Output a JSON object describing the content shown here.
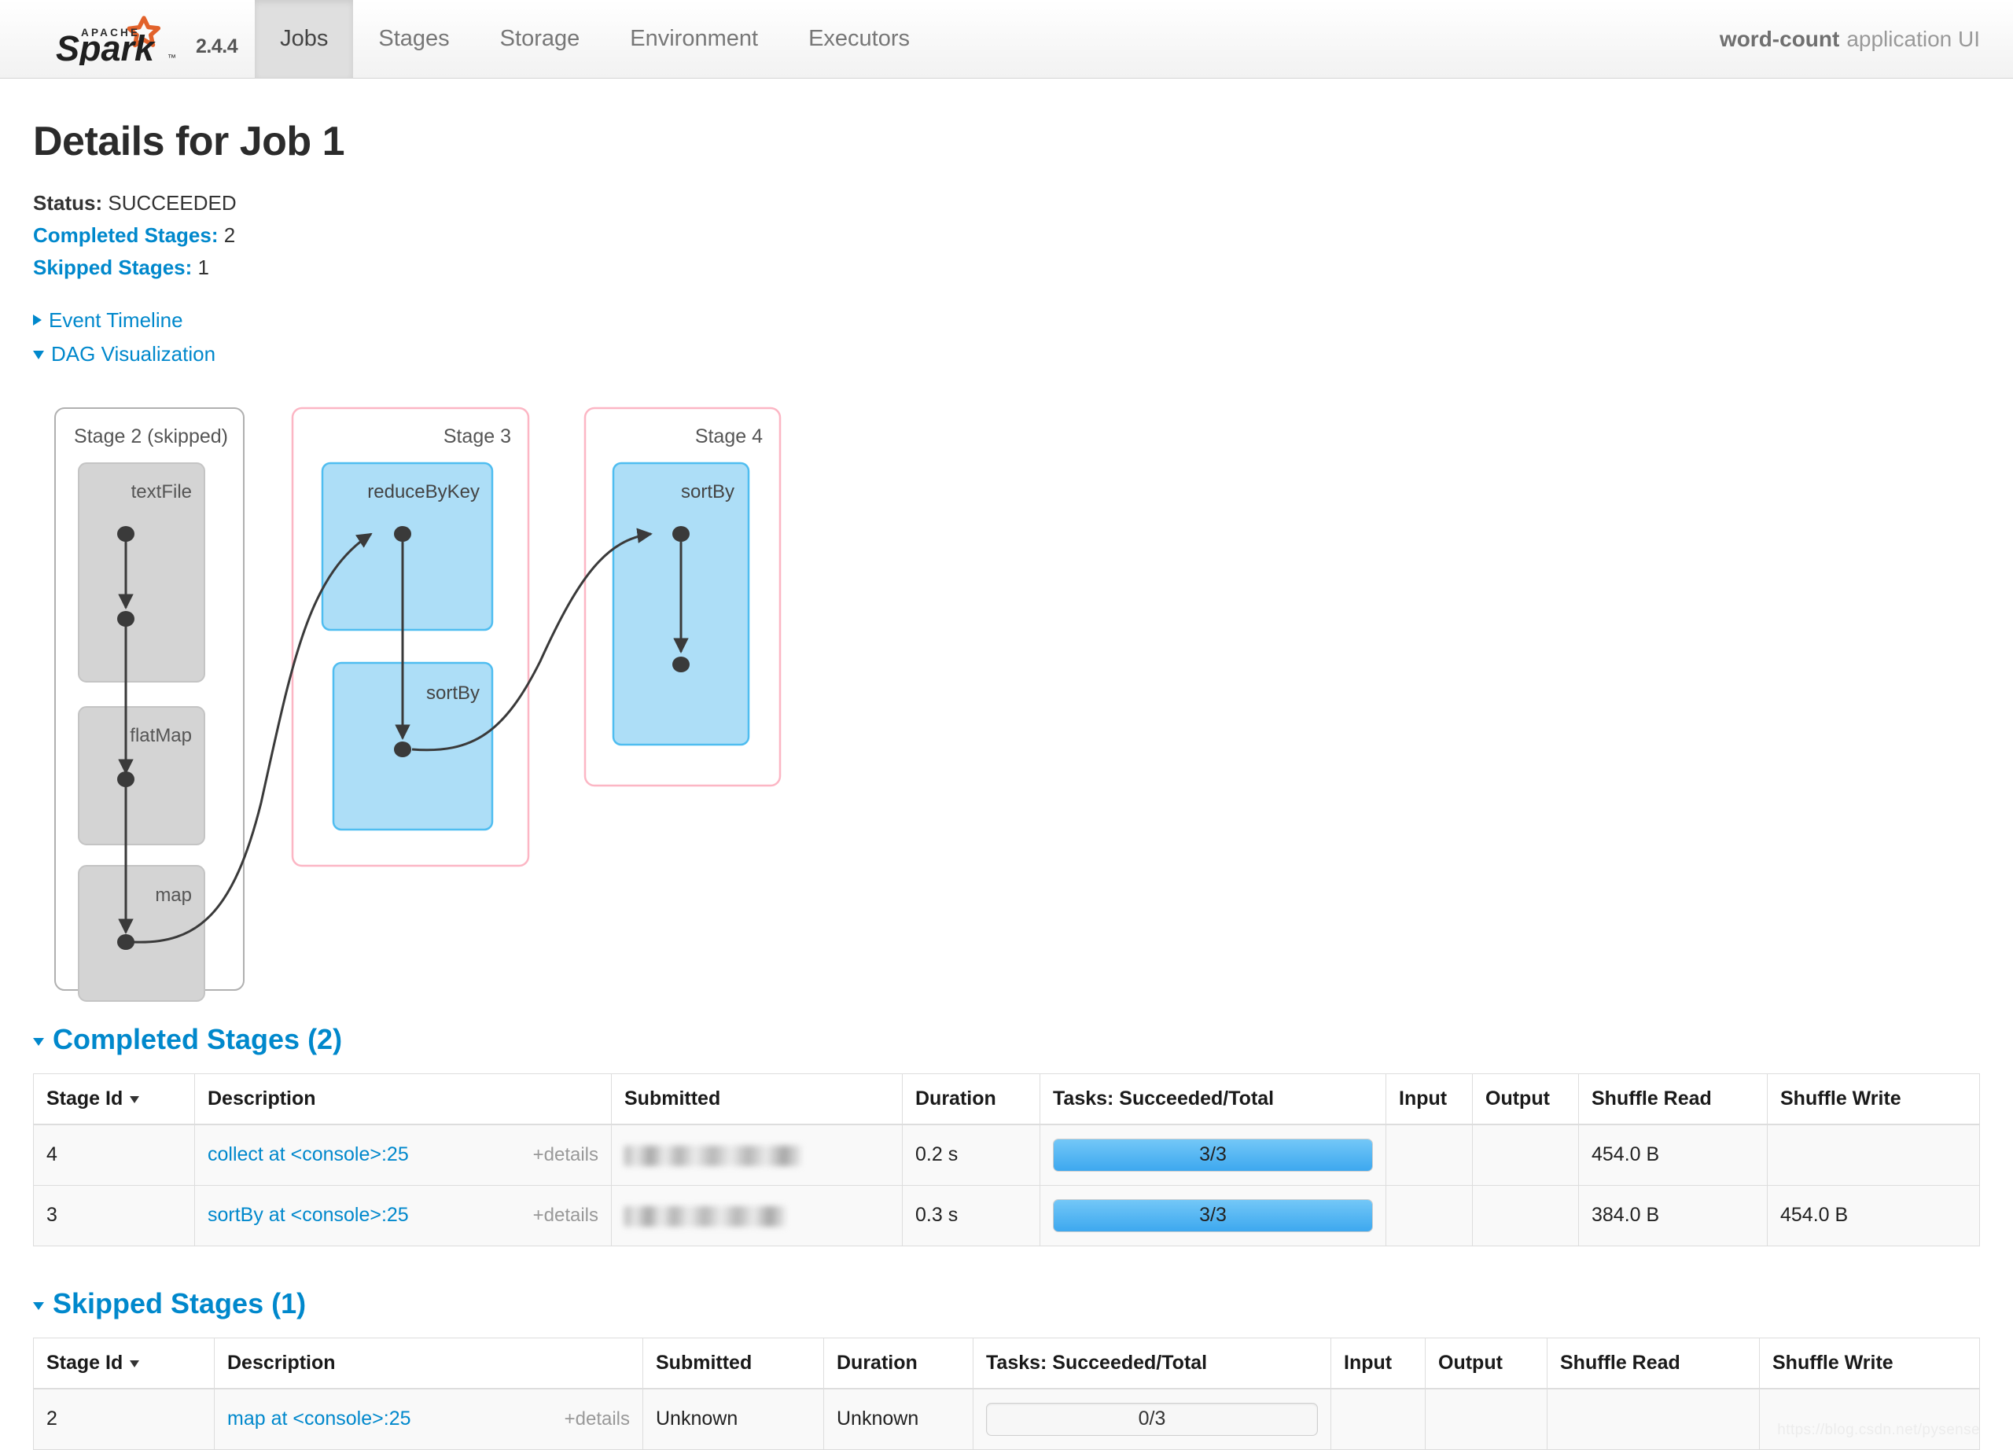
{
  "navbar": {
    "logo_alt": "Apache Spark",
    "version": "2.4.4",
    "tabs": [
      {
        "label": "Jobs",
        "active": true
      },
      {
        "label": "Stages",
        "active": false
      },
      {
        "label": "Storage",
        "active": false
      },
      {
        "label": "Environment",
        "active": false
      },
      {
        "label": "Executors",
        "active": false
      }
    ],
    "app_name": "word-count",
    "app_suffix": "application UI"
  },
  "page": {
    "title": "Details for Job 1",
    "status_label": "Status:",
    "status_value": "SUCCEEDED",
    "completed_label": "Completed Stages:",
    "completed_value": "2",
    "skipped_label": "Skipped Stages:",
    "skipped_value": "1",
    "event_timeline_label": "Event Timeline",
    "dag_label": "DAG Visualization"
  },
  "dag": {
    "stages": [
      {
        "title": "Stage 2 (skipped)",
        "skipped": true,
        "nodes": [
          "textFile",
          "flatMap",
          "map"
        ]
      },
      {
        "title": "Stage 3",
        "skipped": false,
        "nodes": [
          "reduceByKey",
          "sortBy"
        ]
      },
      {
        "title": "Stage 4",
        "skipped": false,
        "nodes": [
          "sortBy"
        ]
      }
    ],
    "colors": {
      "active_fill": "#addef7",
      "active_border": "#4fbdf0",
      "skipped_fill": "#d4d4d4",
      "skipped_border": "#bdbdbd",
      "stage_border_active": "#fcb6c4",
      "stage_border_skipped": "#b0b0b0",
      "edge": "#333333"
    }
  },
  "completed_section": {
    "heading": "Completed Stages (2)",
    "columns": [
      "Stage Id",
      "Description",
      "Submitted",
      "Duration",
      "Tasks: Succeeded/Total",
      "Input",
      "Output",
      "Shuffle Read",
      "Shuffle Write"
    ],
    "rows": [
      {
        "stage_id": "4",
        "description": "collect at <console>:25",
        "details": "+details",
        "submitted": "",
        "submitted_redacted": true,
        "duration": "0.2 s",
        "tasks_text": "3/3",
        "tasks_pct": 100,
        "input": "",
        "output": "",
        "shuffle_read": "454.0 B",
        "shuffle_write": ""
      },
      {
        "stage_id": "3",
        "description": "sortBy at <console>:25",
        "details": "+details",
        "submitted": "",
        "submitted_redacted": true,
        "duration": "0.3 s",
        "tasks_text": "3/3",
        "tasks_pct": 100,
        "input": "",
        "output": "",
        "shuffle_read": "384.0 B",
        "shuffle_write": "454.0 B"
      }
    ]
  },
  "skipped_section": {
    "heading": "Skipped Stages (1)",
    "columns": [
      "Stage Id",
      "Description",
      "Submitted",
      "Duration",
      "Tasks: Succeeded/Total",
      "Input",
      "Output",
      "Shuffle Read",
      "Shuffle Write"
    ],
    "rows": [
      {
        "stage_id": "2",
        "description": "map at <console>:25",
        "details": "+details",
        "submitted": "Unknown",
        "submitted_redacted": false,
        "duration": "Unknown",
        "tasks_text": "0/3",
        "tasks_pct": 0,
        "input": "",
        "output": "",
        "shuffle_read": "",
        "shuffle_write": ""
      }
    ]
  },
  "watermark": "https://blog.csdn.net/pysense"
}
